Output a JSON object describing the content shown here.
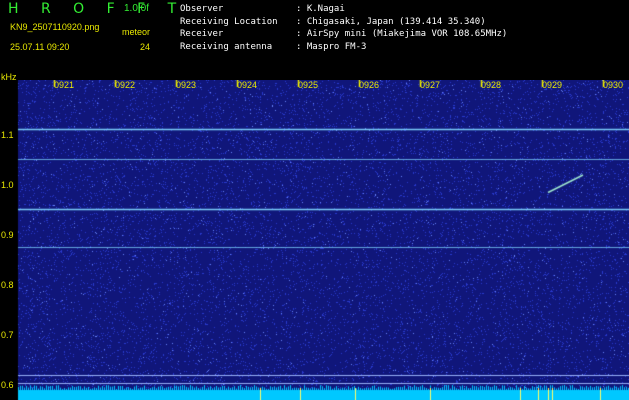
{
  "header": {
    "app_title": "H R O F F T",
    "version": "1.0.0f",
    "file_name": "KN9_2507110920.png",
    "mode": "meteor",
    "timestamp": "25.07.11 09:20",
    "count": "24"
  },
  "info": [
    {
      "label": "Observer",
      "value": ": K.Nagai"
    },
    {
      "label": "Receiving Location",
      "value": ": Chigasaki, Japan (139.414 35.340)"
    },
    {
      "label": "Receiver",
      "value": ": AirSpy mini (Miakejima VOR 108.65MHz)"
    },
    {
      "label": "Receiving antenna",
      "value": ": Maspro FM-3"
    }
  ],
  "spectrogram": {
    "unit_label": "kHz",
    "time_labels": [
      "0921",
      "0922",
      "0923",
      "0924",
      "0925",
      "0926",
      "0927",
      "0928",
      "0929",
      "0930"
    ],
    "freq_labels": [
      "1.1",
      "1.0",
      "0.9",
      "0.8",
      "0.7",
      "0.6"
    ],
    "freq_range_khz": [
      0.57,
      1.21
    ],
    "carrier_lines_khz": [
      1.112,
      1.053,
      0.952,
      0.875,
      0.62,
      0.605
    ],
    "meteor_trace": {
      "start_time": "0929",
      "end_time": "0930",
      "start_khz": 0.985,
      "end_khz": 1.02
    },
    "colors": {
      "background": "#10167a",
      "noise_low": "#2a3ad0",
      "noise_high": "#6a86ff",
      "carrier": "#7fd6ff",
      "baseline": "#00c8ff",
      "label": "#e8e800"
    }
  }
}
